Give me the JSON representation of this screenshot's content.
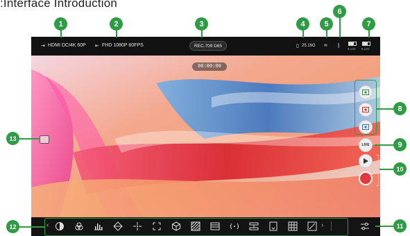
{
  "page": {
    "heading": ":Interface Introduction"
  },
  "statusbar": {
    "input_label": "HDMI DCI4K 60P",
    "output_label": "FHD 1080P 60FPS",
    "lut_label": "REC.709 D65",
    "storage_label": "25.16G",
    "battery1_voltage": "8.14V",
    "battery2_voltage": "8.12V"
  },
  "timecode": "00:00:00",
  "side_controls": {
    "live_label": "LIVE"
  },
  "callouts": {
    "c1": "1",
    "c2": "2",
    "c3": "3",
    "c4": "4",
    "c5": "5",
    "c6": "6",
    "c7": "7",
    "c8": "8",
    "c9": "9",
    "c10": "10",
    "c11": "11",
    "c12": "12",
    "c13": "13"
  },
  "toolbar": {
    "icons": [
      "contrast-icon",
      "color-wheel-icon",
      "histogram-icon",
      "vectorscope-icon",
      "focus-peaking-icon",
      "frame-guide-icon",
      "cube-lut-icon",
      "zebra-icon",
      "waveform-icon",
      "audio-icon",
      "anamorphic-icon",
      "false-color-icon",
      "grid-icon",
      "aspect-icon",
      "next-icon",
      "settings-icon"
    ]
  },
  "colors": {
    "accent": "#2f9c45",
    "record": "#e03a3e",
    "bar": "#121212"
  }
}
